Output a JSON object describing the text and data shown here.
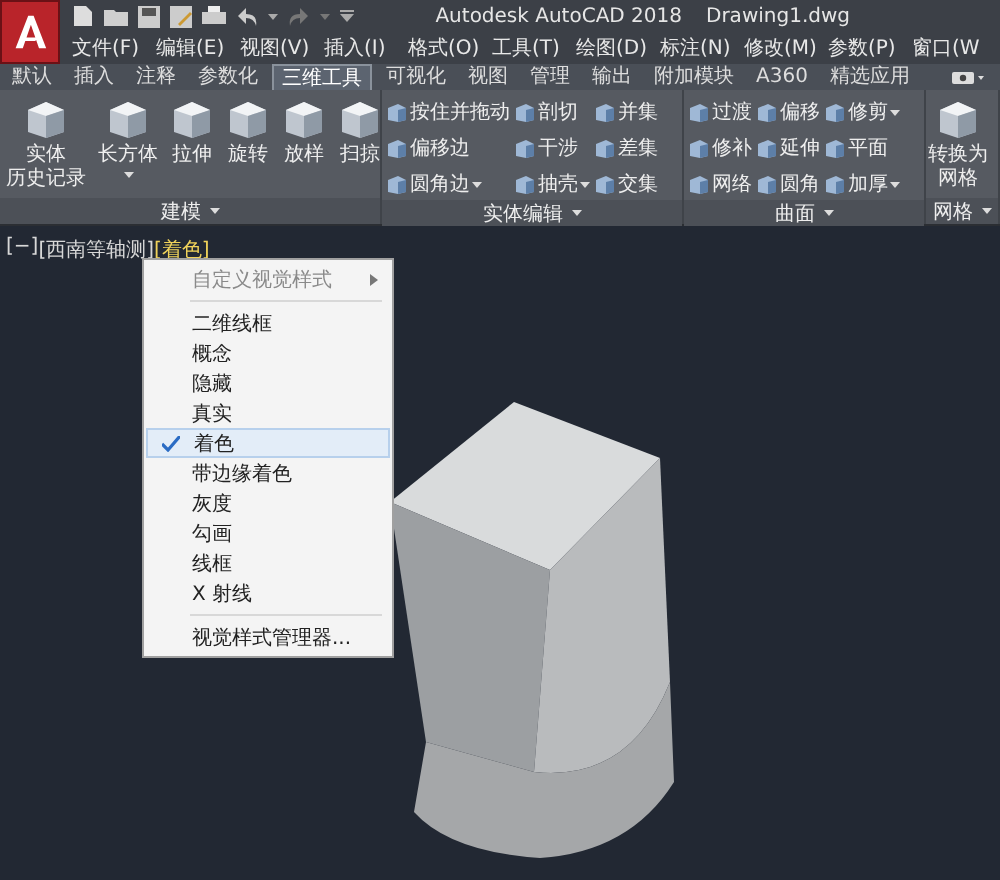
{
  "window": {
    "title": "Autodesk AutoCAD 2018",
    "document": "Drawing1.dwg"
  },
  "menu_bar": [
    "文件(F)",
    "编辑(E)",
    "视图(V)",
    "插入(I)",
    "格式(O)",
    "工具(T)",
    "绘图(D)",
    "标注(N)",
    "修改(M)",
    "参数(P)",
    "窗口(W"
  ],
  "ribbon_tabs": [
    {
      "label": "默认",
      "selected": false
    },
    {
      "label": "插入",
      "selected": false
    },
    {
      "label": "注释",
      "selected": false
    },
    {
      "label": "参数化",
      "selected": false
    },
    {
      "label": "三维工具",
      "selected": true
    },
    {
      "label": "可视化",
      "selected": false
    },
    {
      "label": "视图",
      "selected": false
    },
    {
      "label": "管理",
      "selected": false
    },
    {
      "label": "输出",
      "selected": false
    },
    {
      "label": "附加模块",
      "selected": false
    },
    {
      "label": "A360",
      "selected": false
    },
    {
      "label": "精选应用",
      "selected": false
    }
  ],
  "panels": [
    {
      "title": "建模",
      "kind": "large",
      "tools": [
        {
          "lines": [
            "实体",
            "历史记录"
          ],
          "dropdown": false
        },
        {
          "lines": [
            "长方体"
          ],
          "dropdown": true
        },
        {
          "lines": [
            "拉伸"
          ],
          "dropdown": false
        },
        {
          "lines": [
            "旋转"
          ],
          "dropdown": false
        },
        {
          "lines": [
            "放样"
          ],
          "dropdown": false
        },
        {
          "lines": [
            "扫掠"
          ],
          "dropdown": false
        }
      ]
    },
    {
      "title": "实体编辑",
      "kind": "small",
      "columns": [
        [
          {
            "label": "按住并拖动",
            "dropdown": false
          },
          {
            "label": "偏移边",
            "dropdown": false
          },
          {
            "label": "圆角边",
            "dropdown": true
          }
        ],
        [
          {
            "label": "剖切",
            "dropdown": false
          },
          {
            "label": "干涉",
            "dropdown": false
          },
          {
            "label": "抽壳",
            "dropdown": true
          }
        ],
        [
          {
            "label": "并集",
            "dropdown": false
          },
          {
            "label": "差集",
            "dropdown": false
          },
          {
            "label": "交集",
            "dropdown": false
          }
        ]
      ]
    },
    {
      "title": "曲面",
      "kind": "small",
      "columns": [
        [
          {
            "label": "过渡",
            "dropdown": false
          },
          {
            "label": "修补",
            "dropdown": false
          },
          {
            "label": "网络",
            "dropdown": false
          }
        ],
        [
          {
            "label": "偏移",
            "dropdown": false
          },
          {
            "label": "延伸",
            "dropdown": false
          },
          {
            "label": "圆角",
            "dropdown": false
          }
        ],
        [
          {
            "label": "修剪",
            "dropdown": true
          },
          {
            "label": "平面",
            "dropdown": false
          },
          {
            "label": "加厚",
            "dropdown": true
          }
        ]
      ]
    },
    {
      "title": "网格",
      "kind": "large",
      "tools": [
        {
          "lines": [
            "转换为",
            "网格"
          ],
          "dropdown": false
        }
      ]
    }
  ],
  "viewport": {
    "controls": [
      {
        "label": "[−]",
        "selected": false
      },
      {
        "label": "[西南等轴测]",
        "selected": false
      },
      {
        "label": "[着色]",
        "selected": true
      }
    ]
  },
  "context_menu": [
    {
      "kind": "submenu",
      "label": "自定义视觉样式",
      "disabled": true
    },
    {
      "kind": "separator"
    },
    {
      "kind": "item",
      "label": "二维线框",
      "checked": false
    },
    {
      "kind": "item",
      "label": "概念",
      "checked": false
    },
    {
      "kind": "item",
      "label": "隐藏",
      "checked": false
    },
    {
      "kind": "item",
      "label": "真实",
      "checked": false
    },
    {
      "kind": "item",
      "label": "着色",
      "checked": true
    },
    {
      "kind": "item",
      "label": "带边缘着色",
      "checked": false
    },
    {
      "kind": "item",
      "label": "灰度",
      "checked": false
    },
    {
      "kind": "item",
      "label": "勾画",
      "checked": false
    },
    {
      "kind": "item",
      "label": "线框",
      "checked": false
    },
    {
      "kind": "item",
      "label": "X 射线",
      "checked": false
    },
    {
      "kind": "separator"
    },
    {
      "kind": "item",
      "label": "视觉样式管理器...",
      "checked": false
    }
  ]
}
